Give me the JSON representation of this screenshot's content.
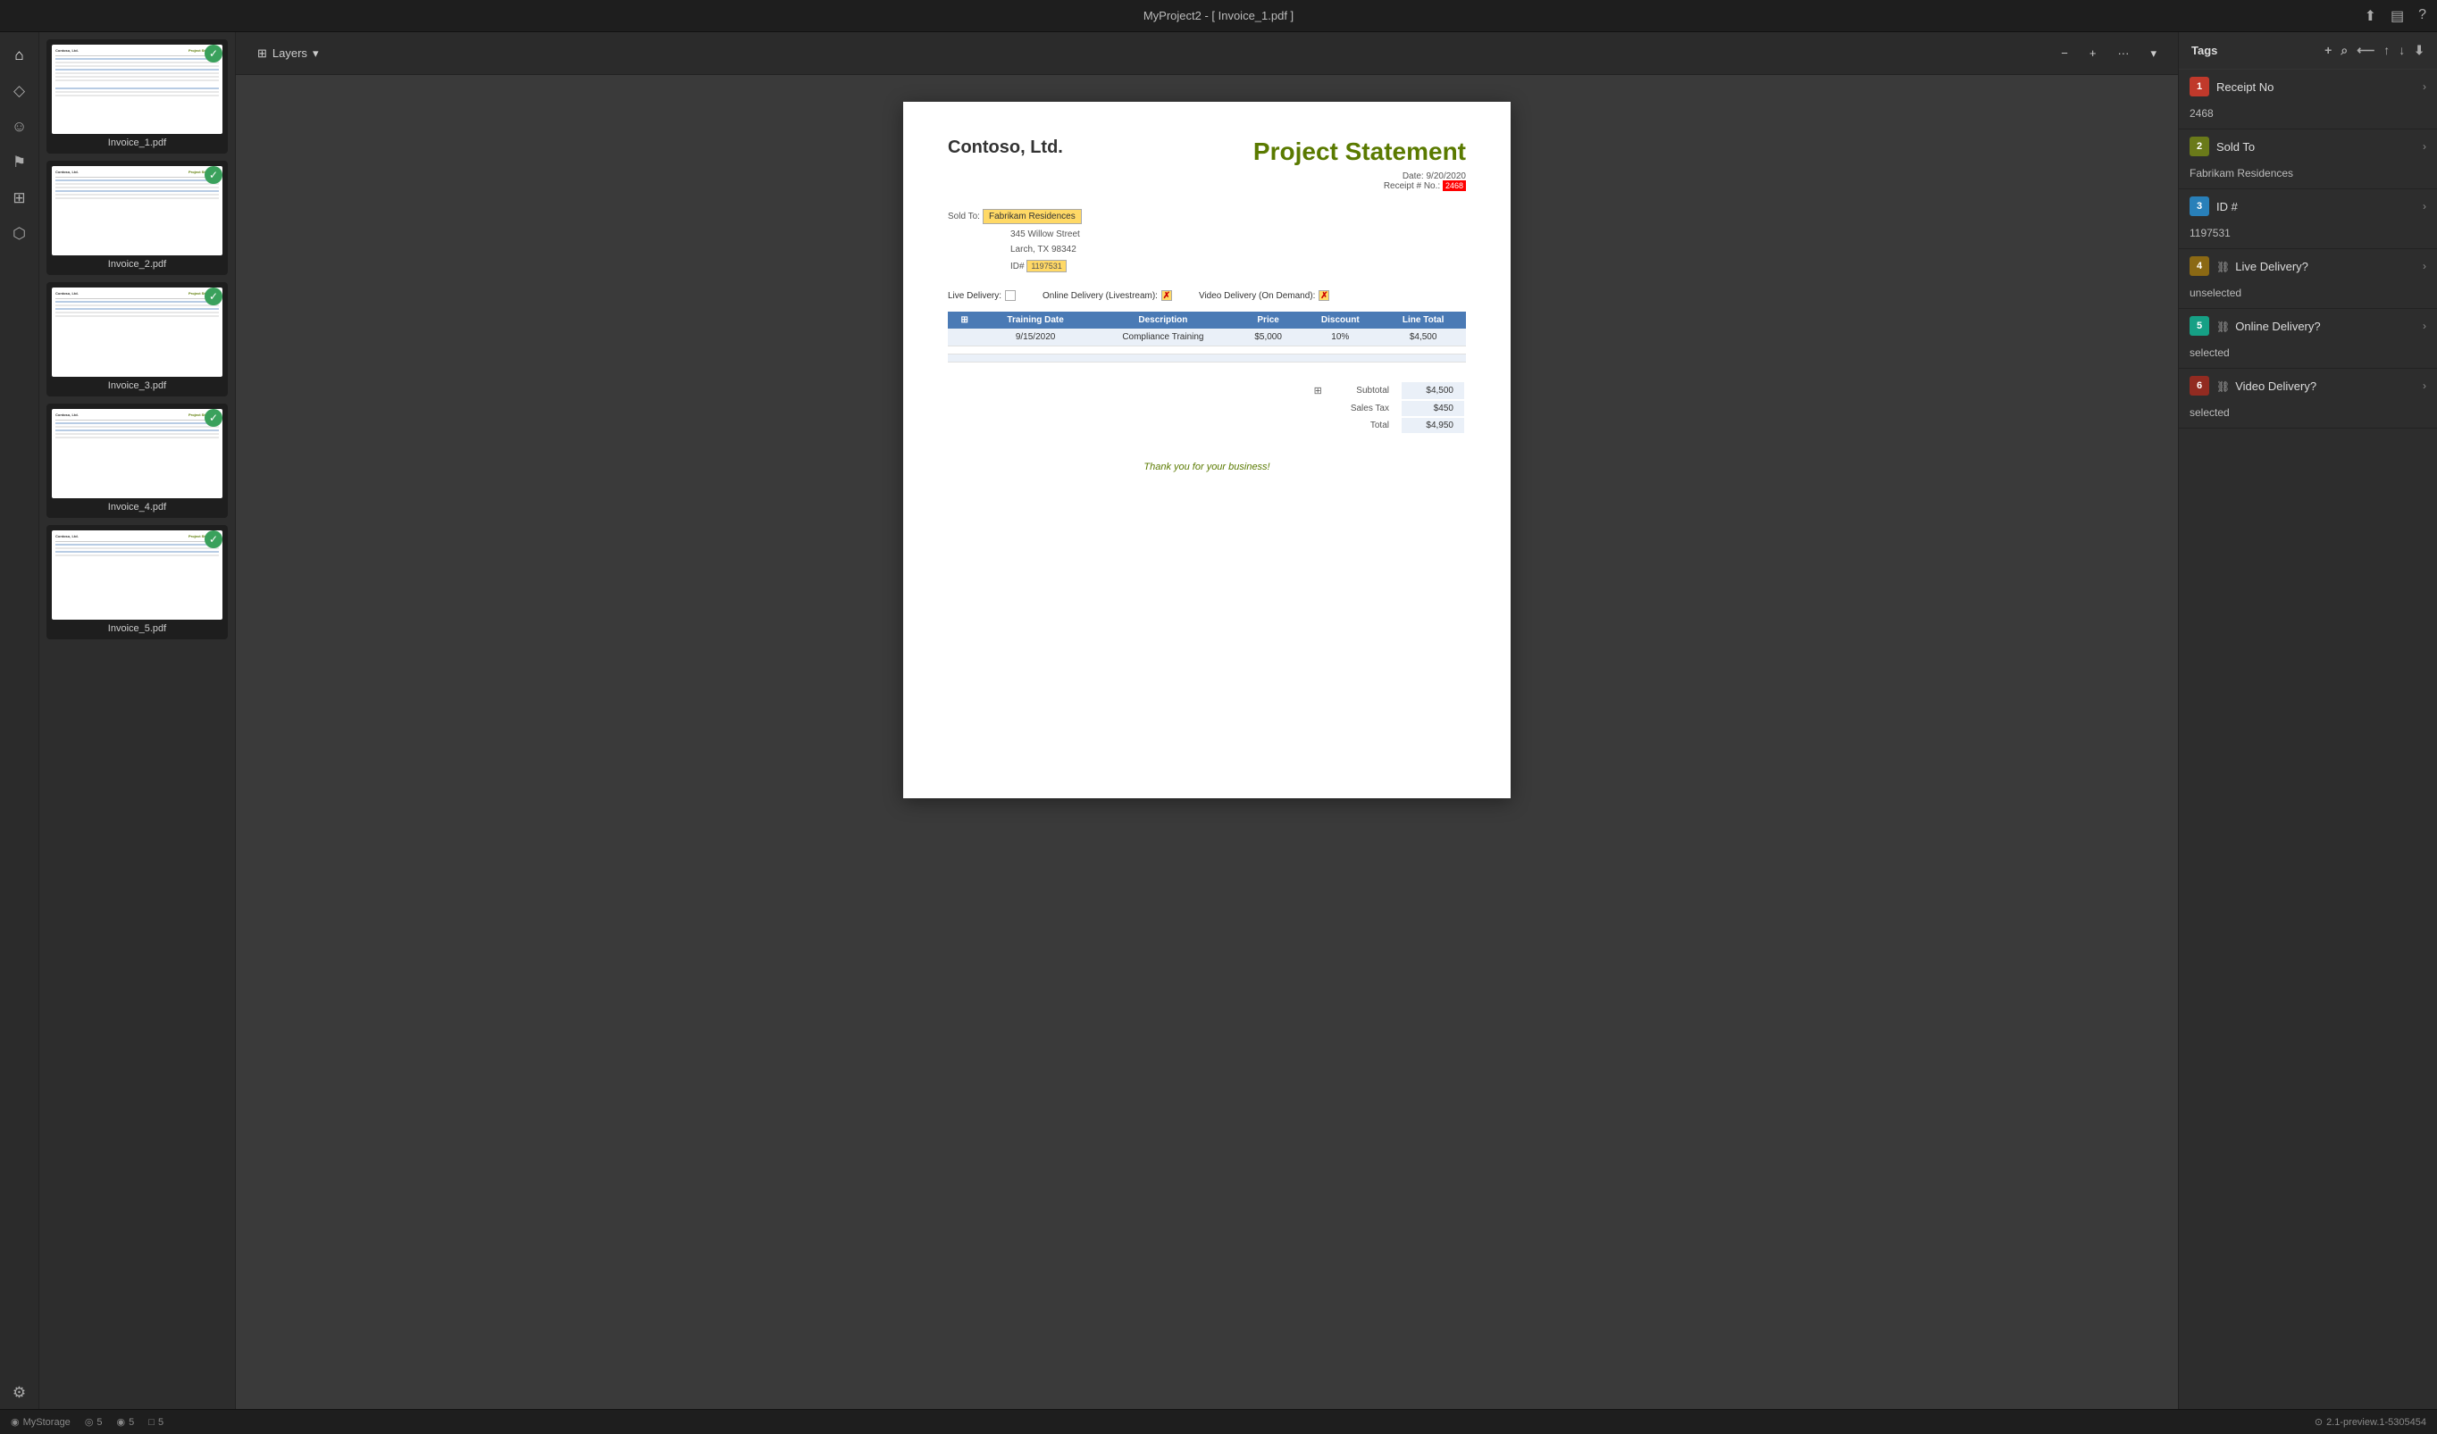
{
  "titlebar": {
    "title": "MyProject2 - [ Invoice_1.pdf ]"
  },
  "sidebar_icons": [
    {
      "name": "home-icon",
      "symbol": "⌂"
    },
    {
      "name": "tag-icon",
      "symbol": "🏷"
    },
    {
      "name": "users-icon",
      "symbol": "☺"
    },
    {
      "name": "map-icon",
      "symbol": "⚑"
    },
    {
      "name": "clipboard-icon",
      "symbol": "📋"
    },
    {
      "name": "plug-icon",
      "symbol": "🔌"
    },
    {
      "name": "settings-icon",
      "symbol": "⚙"
    }
  ],
  "toolbar": {
    "layers_label": "Layers",
    "zoom_out_label": "−",
    "zoom_in_label": "+",
    "more_label": "···",
    "dropdown_label": "▾"
  },
  "thumbnails": [
    {
      "label": "Invoice_1.pdf",
      "checked": true
    },
    {
      "label": "Invoice_2.pdf",
      "checked": true
    },
    {
      "label": "Invoice_3.pdf",
      "checked": true
    },
    {
      "label": "Invoice_4.pdf",
      "checked": true
    },
    {
      "label": "Invoice_5.pdf",
      "checked": true
    }
  ],
  "document": {
    "logo": "Contoso, Ltd.",
    "title": "Project Statement",
    "date_label": "Date:",
    "date_value": "9/20/2020",
    "receipt_label": "Receipt # No.:",
    "receipt_value": "2468",
    "sold_to_label": "Sold To:",
    "sold_to_value": "Fabrikam Residences",
    "address_line1": "345 Willow Street",
    "address_line2": "Larch, TX  98342",
    "id_label": "ID#",
    "id_value": "1197531",
    "live_delivery_label": "Live Delivery:",
    "online_delivery_label": "Online Delivery (Livestream):",
    "video_delivery_label": "Video Delivery (On Demand):",
    "live_checked": false,
    "online_checked": true,
    "video_checked": true,
    "table_headers": [
      "Training Date",
      "Description",
      "Price",
      "Discount",
      "Line Total"
    ],
    "table_rows": [
      {
        "date": "9/15/2020",
        "description": "Compliance Training",
        "price": "$5,000",
        "discount": "10%",
        "total": "$4,500"
      },
      {
        "date": "",
        "description": "",
        "price": "",
        "discount": "",
        "total": ""
      },
      {
        "date": "",
        "description": "",
        "price": "",
        "discount": "",
        "total": ""
      }
    ],
    "subtotal_label": "Subtotal",
    "subtotal_value": "$4,500",
    "tax_label": "Sales Tax",
    "tax_value": "$450",
    "total_label": "Total",
    "total_value": "$4,950",
    "thank_you": "Thank you for your business!"
  },
  "tags": {
    "header": "Tags",
    "items": [
      {
        "name": "Receipt No",
        "badge": "1",
        "badge_class": "badge-red",
        "value": "2468",
        "has_icon": false
      },
      {
        "name": "Sold To",
        "badge": "2",
        "badge_class": "badge-olive",
        "value": "Fabrikam Residences",
        "has_icon": false
      },
      {
        "name": "ID #",
        "badge": "3",
        "badge_class": "badge-blue",
        "value": "1197531",
        "has_icon": false
      },
      {
        "name": "Live Delivery?",
        "badge": "4",
        "badge_class": "badge-brown",
        "value": "unselected",
        "has_icon": true
      },
      {
        "name": "Online Delivery?",
        "badge": "5",
        "badge_class": "badge-teal",
        "value": "selected",
        "has_icon": true
      },
      {
        "name": "Video Delivery?",
        "badge": "6",
        "badge_class": "badge-darkred",
        "value": "selected",
        "has_icon": true
      }
    ]
  },
  "statusbar": {
    "storage_label": "MyStorage",
    "count1": "5",
    "count2": "5",
    "count3": "5",
    "version": "2.1-preview.1-5305454"
  }
}
